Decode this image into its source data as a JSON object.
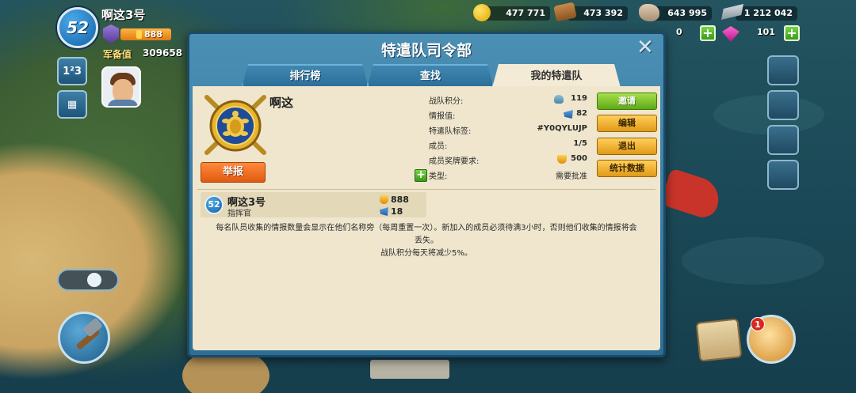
{
  "player": {
    "level": "52",
    "name": "啊这3号",
    "medals": "888",
    "army_label": "军备值",
    "army_value": "309658"
  },
  "resources": {
    "gold": "477 771",
    "wood": "473 392",
    "stone": "643 995",
    "iron": "1 212 042",
    "secondary": "0",
    "diamonds": "101"
  },
  "hud": {
    "notification_count": "1"
  },
  "dialog": {
    "title": "特遣队司令部",
    "close": "✕",
    "tabs": [
      {
        "label": "排行榜"
      },
      {
        "label": "查找"
      },
      {
        "label": "我的特遣队"
      }
    ]
  },
  "team": {
    "name": "啊这",
    "report_label": "举报",
    "stats": [
      {
        "label": "战队积分:",
        "value": "119"
      },
      {
        "label": "情报值:",
        "value": "82"
      },
      {
        "label": "特遣队标签:",
        "value": "#Y0QYLUJP"
      },
      {
        "label": "成员:",
        "value": "1/5"
      },
      {
        "label": "成员奖牌要求:",
        "value": "500"
      },
      {
        "label": "类型:",
        "value": "需要批准"
      }
    ],
    "actions": [
      {
        "label": "邀请"
      },
      {
        "label": "编辑"
      },
      {
        "label": "退出"
      },
      {
        "label": "统计数据"
      }
    ]
  },
  "members": [
    {
      "level": "52",
      "name": "啊这3号",
      "role": "指挥官",
      "medals": "888",
      "intel": "18"
    }
  ],
  "info_text": {
    "line1": "每名队员收集的情报数量会显示在他们名称旁（每周重置一次）。新加入的成员必须待满3小时，否则他们收集的情报将会",
    "line2": "丢失。",
    "line3": "战队积分每天将减少5%。"
  },
  "colors": {
    "dialog_blue": "#3f87b2",
    "panel_beige": "#efe6cd",
    "report_orange": "#e05a12",
    "invite_green": "#5fa818",
    "action_gold": "#e09a18"
  }
}
